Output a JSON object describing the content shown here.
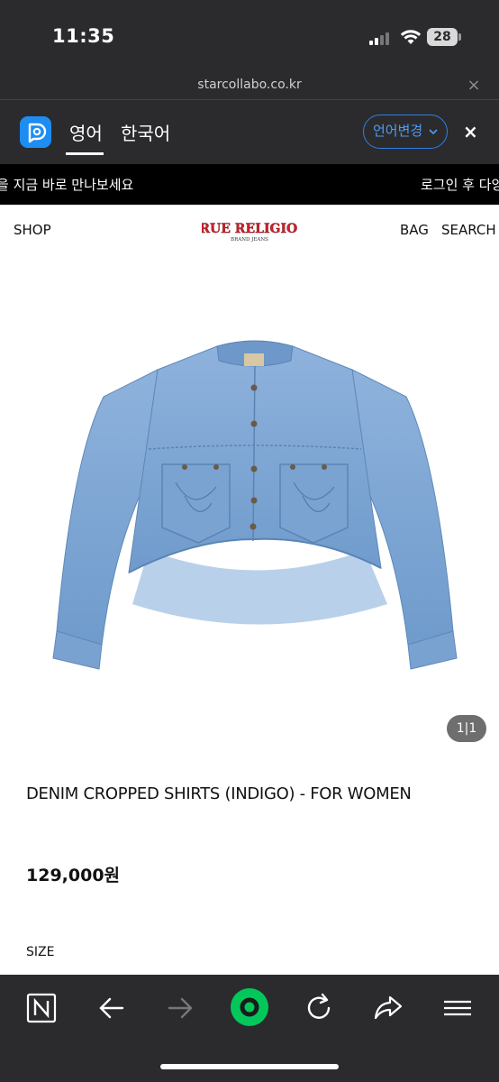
{
  "status_bar": {
    "time": "11:35",
    "battery": "28"
  },
  "browser": {
    "url": "starcollabo.co.kr",
    "close_glyph": "×"
  },
  "translate_bar": {
    "language_primary": "영어",
    "language_secondary": "한국어",
    "change_language_label": "언어변경",
    "close_glyph": "×"
  },
  "marquee": {
    "left_text": "을 지금 바로 만나보세요",
    "right_text": "로그인 후 다양"
  },
  "site_header": {
    "shop_label": "SHOP",
    "logo_text": "TRUE RELIGION",
    "logo_subtext": "BRAND JEANS",
    "bag_label": "BAG",
    "search_label": "SEARCH"
  },
  "product": {
    "image_counter": "1|1",
    "title": "DENIM CROPPED SHIRTS (INDIGO) - FOR WOMEN",
    "price": "129,000원",
    "size_label": "SIZE"
  },
  "colors": {
    "chrome": "#2b2b2e",
    "papago_blue": "#1d8df2",
    "toolbar_green": "#03c75a",
    "logo_red": "#c8232c",
    "denim": "#7ea6d3"
  },
  "toolbar_icons": [
    "naver-n-icon",
    "back-icon",
    "forward-icon",
    "green-dot-icon",
    "reload-icon",
    "share-icon",
    "menu-icon"
  ]
}
